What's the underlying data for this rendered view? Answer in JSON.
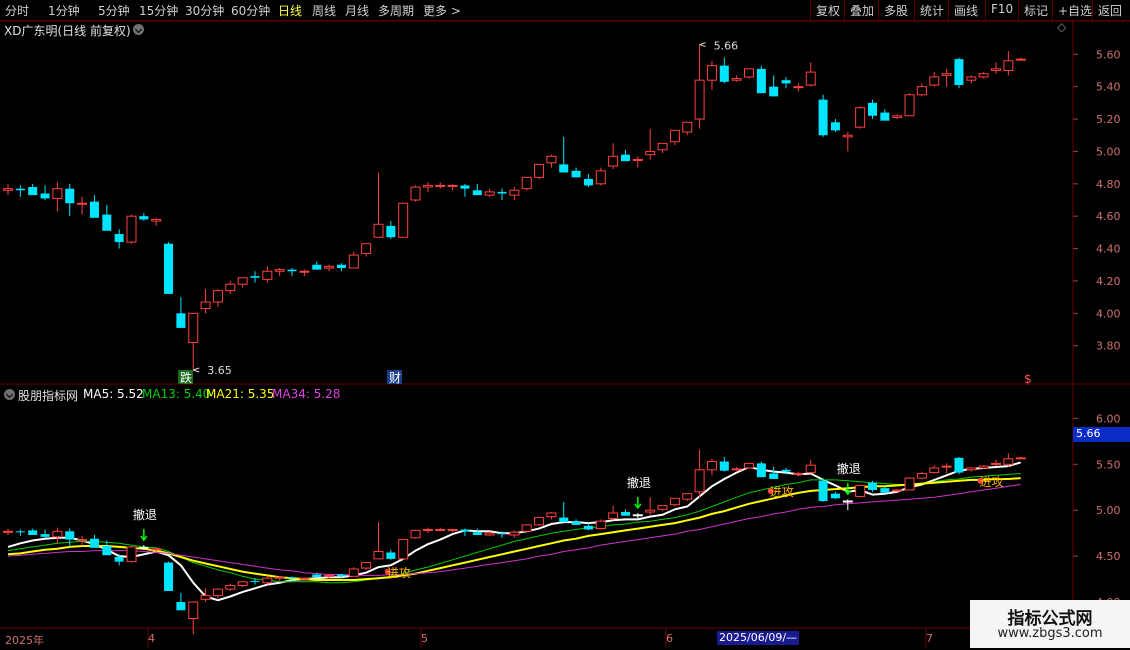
{
  "toolbar": {
    "periods": [
      "分时",
      "1分钟",
      "5分钟",
      "15分钟",
      "30分钟",
      "60分钟",
      "日线",
      "周线",
      "月线",
      "多周期",
      "更多 >"
    ],
    "active_index": 6,
    "right_buttons": [
      "复权",
      "叠加",
      "多股",
      "统计",
      "画线",
      "F10",
      "标记",
      "+自选",
      "返回"
    ]
  },
  "main_chart": {
    "title": "XD广东明(日线 前复权)",
    "high_marker": "5.66",
    "low_marker": "3.65",
    "tag_die": "跌",
    "tag_cai": "财",
    "tag_dollar": "$",
    "y_ticks": [
      "5.60",
      "5.40",
      "5.20",
      "5.00",
      "4.80",
      "4.60",
      "4.40",
      "4.20",
      "4.00",
      "3.80"
    ],
    "y_range": [
      3.65,
      5.75
    ]
  },
  "indicator": {
    "name": "股朋指标网",
    "ma5": "MA5: 5.52",
    "ma13": "MA13: 5.40",
    "ma21": "MA21: 5.35",
    "ma34": "MA34: 5.28",
    "price_tag": "5.66",
    "y_ticks": [
      "6.00",
      "5.50",
      "5.00",
      "4.50",
      "4.00"
    ],
    "y_range": [
      3.75,
      6.2
    ],
    "signals": {
      "retreat": "撤退",
      "attack": "进攻"
    },
    "colors": {
      "ma5": "#ffffff",
      "ma13": "#00cc00",
      "ma21": "#ffff00",
      "ma34": "#cc33cc"
    }
  },
  "x_axis": {
    "labels": [
      "2025年",
      "4",
      "5",
      "6",
      "7"
    ],
    "cursor_date": "2025/06/09/—"
  },
  "watermark": {
    "line1": "指标公式网",
    "line2": "www.zbgs3.com"
  },
  "colors": {
    "up": "#ff4040",
    "down": "#00e5ff",
    "bg": "#000000",
    "grid": "#6a0000"
  },
  "chart_data": {
    "type": "candlestick",
    "series": [
      {
        "name": "OHLC",
        "values": [
          [
            4.76,
            4.8,
            4.73,
            4.77
          ],
          [
            4.77,
            4.79,
            4.72,
            4.76
          ],
          [
            4.78,
            4.8,
            4.75,
            4.73
          ],
          [
            4.74,
            4.79,
            4.7,
            4.71
          ],
          [
            4.71,
            4.81,
            4.63,
            4.77
          ],
          [
            4.77,
            4.8,
            4.6,
            4.68
          ],
          [
            4.68,
            4.72,
            4.61,
            4.68
          ],
          [
            4.69,
            4.73,
            4.63,
            4.59
          ],
          [
            4.61,
            4.67,
            4.59,
            4.51
          ],
          [
            4.49,
            4.52,
            4.4,
            4.44
          ],
          [
            4.44,
            4.61,
            4.43,
            4.6
          ],
          [
            4.6,
            4.62,
            4.57,
            4.58
          ],
          [
            4.57,
            4.59,
            4.54,
            4.58
          ],
          [
            4.43,
            4.44,
            4.12,
            4.12
          ],
          [
            4.0,
            4.1,
            3.93,
            3.91
          ],
          [
            3.82,
            4.0,
            3.65,
            4.0
          ],
          [
            4.03,
            4.15,
            4.0,
            4.07
          ],
          [
            4.07,
            4.15,
            4.04,
            4.14
          ],
          [
            4.14,
            4.2,
            4.12,
            4.18
          ],
          [
            4.18,
            4.22,
            4.16,
            4.22
          ],
          [
            4.23,
            4.26,
            4.19,
            4.22
          ],
          [
            4.21,
            4.29,
            4.19,
            4.26
          ],
          [
            4.26,
            4.28,
            4.23,
            4.27
          ],
          [
            4.27,
            4.28,
            4.23,
            4.26
          ],
          [
            4.26,
            4.27,
            4.23,
            4.26
          ],
          [
            4.3,
            4.32,
            4.27,
            4.27
          ],
          [
            4.28,
            4.3,
            4.26,
            4.29
          ],
          [
            4.3,
            4.31,
            4.26,
            4.28
          ],
          [
            4.28,
            4.38,
            4.28,
            4.36
          ],
          [
            4.37,
            4.43,
            4.35,
            4.43
          ],
          [
            4.47,
            4.87,
            4.47,
            4.55
          ],
          [
            4.54,
            4.57,
            4.46,
            4.47
          ],
          [
            4.47,
            4.68,
            4.47,
            4.68
          ],
          [
            4.7,
            4.79,
            4.69,
            4.78
          ],
          [
            4.78,
            4.81,
            4.75,
            4.79
          ],
          [
            4.79,
            4.81,
            4.77,
            4.79
          ],
          [
            4.79,
            4.8,
            4.76,
            4.79
          ],
          [
            4.79,
            4.8,
            4.72,
            4.77
          ],
          [
            4.76,
            4.8,
            4.74,
            4.73
          ],
          [
            4.73,
            4.77,
            4.72,
            4.75
          ],
          [
            4.75,
            4.77,
            4.7,
            4.74
          ],
          [
            4.73,
            4.78,
            4.7,
            4.76
          ],
          [
            4.77,
            4.84,
            4.76,
            4.84
          ],
          [
            4.84,
            4.92,
            4.83,
            4.92
          ],
          [
            4.93,
            4.98,
            4.9,
            4.97
          ],
          [
            4.92,
            5.09,
            4.88,
            4.87
          ],
          [
            4.88,
            4.9,
            4.84,
            4.84
          ],
          [
            4.83,
            4.86,
            4.78,
            4.79
          ],
          [
            4.8,
            4.9,
            4.79,
            4.88
          ],
          [
            4.91,
            5.05,
            4.89,
            4.97
          ],
          [
            4.98,
            5.01,
            4.94,
            4.94
          ],
          [
            4.95,
            4.97,
            4.9,
            4.95
          ],
          [
            4.98,
            5.14,
            4.95,
            5.0
          ],
          [
            5.01,
            5.05,
            4.99,
            5.05
          ],
          [
            5.06,
            5.13,
            5.04,
            5.13
          ],
          [
            5.12,
            5.17,
            5.1,
            5.18
          ],
          [
            5.2,
            5.66,
            5.14,
            5.44
          ],
          [
            5.44,
            5.56,
            5.38,
            5.53
          ],
          [
            5.53,
            5.58,
            5.42,
            5.43
          ],
          [
            5.44,
            5.47,
            5.43,
            5.45
          ],
          [
            5.46,
            5.51,
            5.45,
            5.51
          ],
          [
            5.51,
            5.53,
            5.36,
            5.36
          ],
          [
            5.4,
            5.47,
            5.34,
            5.34
          ],
          [
            5.44,
            5.46,
            5.39,
            5.42
          ],
          [
            5.4,
            5.42,
            5.37,
            5.4
          ],
          [
            5.41,
            5.55,
            5.4,
            5.49
          ],
          [
            5.32,
            5.35,
            5.09,
            5.1
          ],
          [
            5.18,
            5.2,
            5.12,
            5.13
          ],
          [
            5.09,
            5.12,
            5.0,
            5.1
          ],
          [
            5.15,
            5.28,
            5.14,
            5.27
          ],
          [
            5.3,
            5.32,
            5.2,
            5.22
          ],
          [
            5.24,
            5.26,
            5.2,
            5.19
          ],
          [
            5.21,
            5.23,
            5.2,
            5.22
          ],
          [
            5.22,
            5.36,
            5.22,
            5.35
          ],
          [
            5.35,
            5.42,
            5.34,
            5.4
          ],
          [
            5.41,
            5.49,
            5.4,
            5.46
          ],
          [
            5.47,
            5.51,
            5.4,
            5.48
          ],
          [
            5.57,
            5.58,
            5.39,
            5.41
          ],
          [
            5.44,
            5.47,
            5.42,
            5.46
          ],
          [
            5.46,
            5.49,
            5.45,
            5.48
          ],
          [
            5.5,
            5.55,
            5.48,
            5.51
          ],
          [
            5.5,
            5.62,
            5.47,
            5.56
          ],
          [
            5.57,
            5.58,
            5.56,
            5.57
          ]
        ]
      }
    ],
    "indicator_series": [
      {
        "name": "MA5",
        "values": [
          4.6,
          4.64,
          4.67,
          4.69,
          4.7,
          4.7,
          4.67,
          4.63,
          4.57,
          4.5,
          4.49,
          4.52,
          4.55,
          4.51,
          4.4,
          4.21,
          4.06,
          4.02,
          4.06,
          4.11,
          4.15,
          4.19,
          4.21,
          4.24,
          4.25,
          4.26,
          4.27,
          4.27,
          4.29,
          4.32,
          4.38,
          4.4,
          4.47,
          4.56,
          4.63,
          4.68,
          4.74,
          4.78,
          4.77,
          4.77,
          4.75,
          4.75,
          4.77,
          4.8,
          4.85,
          4.87,
          4.87,
          4.86,
          4.87,
          4.89,
          4.9,
          4.9,
          4.93,
          4.95,
          5.01,
          5.04,
          5.15,
          5.26,
          5.34,
          5.41,
          5.47,
          5.44,
          5.42,
          5.41,
          5.39,
          5.4,
          5.33,
          5.27,
          5.2,
          5.22,
          5.17,
          5.18,
          5.2,
          5.25,
          5.28,
          5.33,
          5.38,
          5.43,
          5.45,
          5.46,
          5.47,
          5.48,
          5.52
        ]
      },
      {
        "name": "MA13",
        "values": [
          4.56,
          4.58,
          4.6,
          4.62,
          4.64,
          4.65,
          4.66,
          4.66,
          4.65,
          4.64,
          4.62,
          4.6,
          4.59,
          4.55,
          4.49,
          4.43,
          4.39,
          4.35,
          4.32,
          4.28,
          4.25,
          4.24,
          4.22,
          4.22,
          4.22,
          4.22,
          4.21,
          4.21,
          4.22,
          4.24,
          4.26,
          4.28,
          4.31,
          4.35,
          4.38,
          4.42,
          4.46,
          4.5,
          4.54,
          4.58,
          4.62,
          4.66,
          4.69,
          4.72,
          4.75,
          4.77,
          4.79,
          4.81,
          4.82,
          4.84,
          4.85,
          4.87,
          4.88,
          4.9,
          4.92,
          4.95,
          4.99,
          5.04,
          5.09,
          5.14,
          5.19,
          5.22,
          5.25,
          5.28,
          5.3,
          5.33,
          5.33,
          5.33,
          5.32,
          5.31,
          5.3,
          5.29,
          5.28,
          5.28,
          5.29,
          5.31,
          5.33,
          5.34,
          5.36,
          5.37,
          5.38,
          5.39,
          5.4
        ]
      },
      {
        "name": "MA21",
        "values": [
          4.52,
          4.53,
          4.55,
          4.57,
          4.58,
          4.6,
          4.61,
          4.61,
          4.61,
          4.6,
          4.59,
          4.58,
          4.56,
          4.53,
          4.49,
          4.45,
          4.42,
          4.39,
          4.36,
          4.33,
          4.31,
          4.29,
          4.27,
          4.26,
          4.25,
          4.24,
          4.24,
          4.24,
          4.24,
          4.25,
          4.26,
          4.27,
          4.29,
          4.31,
          4.34,
          4.37,
          4.4,
          4.43,
          4.46,
          4.49,
          4.52,
          4.55,
          4.58,
          4.61,
          4.64,
          4.67,
          4.69,
          4.72,
          4.74,
          4.76,
          4.78,
          4.8,
          4.82,
          4.84,
          4.86,
          4.89,
          4.92,
          4.96,
          4.99,
          5.03,
          5.07,
          5.1,
          5.13,
          5.16,
          5.19,
          5.21,
          5.22,
          5.23,
          5.24,
          5.25,
          5.26,
          5.26,
          5.27,
          5.28,
          5.29,
          5.3,
          5.31,
          5.32,
          5.33,
          5.33,
          5.34,
          5.34,
          5.35
        ]
      },
      {
        "name": "MA34",
        "values": [
          4.5,
          4.51,
          4.52,
          4.53,
          4.54,
          4.55,
          4.55,
          4.56,
          4.56,
          4.56,
          4.56,
          4.55,
          4.54,
          4.53,
          4.51,
          4.49,
          4.47,
          4.45,
          4.43,
          4.41,
          4.39,
          4.37,
          4.35,
          4.34,
          4.32,
          4.31,
          4.3,
          4.3,
          4.29,
          4.29,
          4.29,
          4.3,
          4.3,
          4.31,
          4.32,
          4.33,
          4.35,
          4.37,
          4.39,
          4.41,
          4.43,
          4.45,
          4.47,
          4.5,
          4.52,
          4.55,
          4.57,
          4.59,
          4.62,
          4.64,
          4.66,
          4.68,
          4.7,
          4.72,
          4.74,
          4.77,
          4.79,
          4.82,
          4.85,
          4.88,
          4.91,
          4.93,
          4.96,
          4.98,
          5.01,
          5.03,
          5.04,
          5.06,
          5.07,
          5.08,
          5.09,
          5.1,
          5.11,
          5.12,
          5.13,
          5.14,
          5.16,
          5.18,
          5.2,
          5.22,
          5.24,
          5.26,
          5.28
        ]
      }
    ],
    "retreat_signals": [
      11,
      51,
      68
    ],
    "attack_signals": [
      31,
      62,
      79
    ],
    "xlabel": "",
    "ylabel": ""
  }
}
